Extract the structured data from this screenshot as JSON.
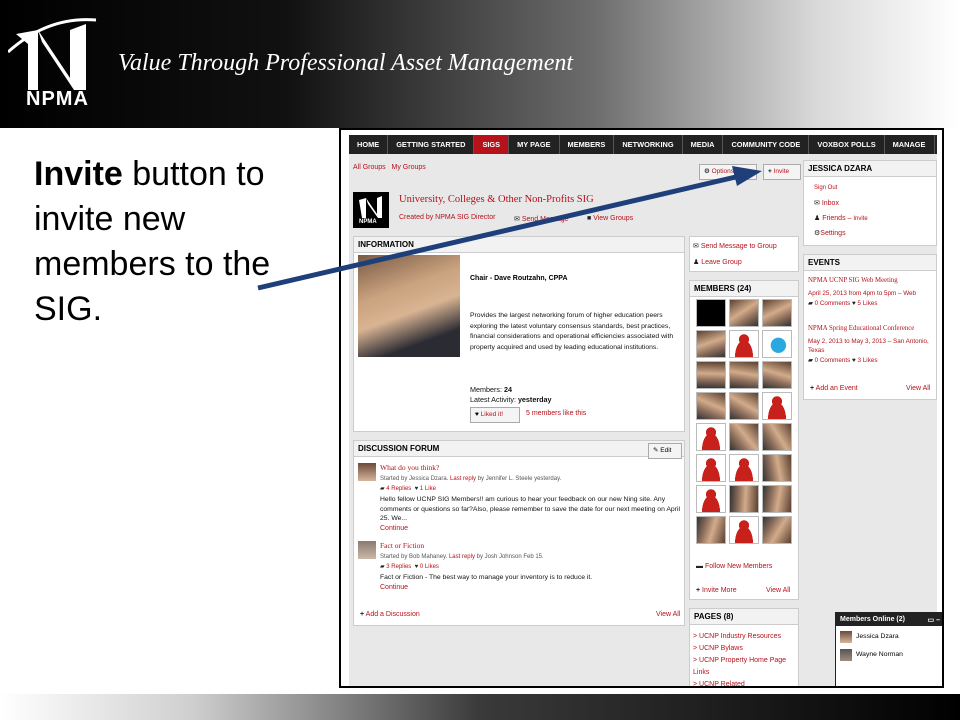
{
  "banner": {
    "logo_text": "NPMA",
    "tagline": "Value Through Professional Asset Management"
  },
  "callout": {
    "bold": "Invite",
    "rest": " button to invite new members to the SIG."
  },
  "nav": [
    "HOME",
    "GETTING STARTED",
    "SIGS",
    "MY PAGE",
    "MEMBERS",
    "NETWORKING",
    "MEDIA",
    "COMMUNITY CODE",
    "VOXBOX POLLS",
    "MANAGE"
  ],
  "crumbs": {
    "all_groups": "All Groups",
    "my_groups": "My Groups"
  },
  "buttons": {
    "options": "Options",
    "invite": "Invite"
  },
  "group": {
    "logo_text": "NPMA",
    "title": "University, Colleges & Other Non-Profits SIG",
    "created_by": "Created by NPMA SIG Director",
    "send_message": "Send Message",
    "view_groups": "View Groups"
  },
  "information": {
    "heading": "INFORMATION",
    "chair": "Chair - Dave Routzahn, CPPA",
    "description": "Provides the largest networking forum of higher education peers exploring the latest voluntary consensus standards, best practices, financial considerations and operational efficiencies associated  with property acquired and used by leading educational institutions.",
    "members_label": "Members: ",
    "members_count": "24",
    "activity_label": "Latest Activity: ",
    "activity_value": "yesterday",
    "liked_btn": "Liked it!",
    "likes_text": "5 members like this"
  },
  "group_actions": {
    "send_message": "Send Message to Group",
    "leave": "Leave Group"
  },
  "members": {
    "heading": "MEMBERS (24)",
    "follow": "Follow New Members",
    "invite_more": "Invite More",
    "view_all": "View All"
  },
  "pages": {
    "heading": "PAGES (8)",
    "items": [
      "> UCNP Industry Resources",
      "> UCNP Bylaws",
      "> UCNP Property Home Page Links",
      "> UCNP Related"
    ]
  },
  "forum": {
    "heading": "DISCUSSION FORUM",
    "edit": "Edit",
    "posts": [
      {
        "title": "What do you think?",
        "meta_pre": "Started by Jessica Dzara. ",
        "meta_link": "Last reply",
        "meta_post": " by Jennifer L. Steele yesterday.",
        "replies": "4 Replies",
        "likes": "1 Like",
        "body": "Hello fellow UCNP SIG Members!! am curious to hear your feedback on our new Ning site. Any comments or questions so far?Also, please remember to save the date for our next meeting on April 25. We...",
        "continue": "Continue"
      },
      {
        "title": "Fact or Fiction",
        "meta_pre": "Started by Bob Mahaney. ",
        "meta_link": "Last reply",
        "meta_post": " by Josh Johnson Feb 15.",
        "replies": "3 Replies",
        "likes": "0 Likes",
        "body": "Fact or Fiction - The best way to manage your inventory is to reduce it.",
        "continue": "Continue"
      }
    ],
    "add": "Add a Discussion",
    "view_all": "View All"
  },
  "user": {
    "name": "JESSICA DZARA",
    "sign_out": "Sign Out",
    "inbox": "Inbox",
    "friends": "Friends",
    "invite": "Invite",
    "settings": "Settings"
  },
  "events": {
    "heading": "EVENTS",
    "items": [
      {
        "title": "NPMA UCNP SIG Web Meeting",
        "when": "April 25, 2013 from 4pm to 5pm – Web",
        "comments": "0 Comments",
        "likes": "5 Likes"
      },
      {
        "title": "NPMA Spring Educational Conference",
        "when": "May 2, 2013 to May 3, 2013 – San Antonio, Texas",
        "comments": "0 Comments",
        "likes": "3 Likes"
      }
    ],
    "add": "Add an Event",
    "view_all": "View All"
  },
  "online": {
    "heading": "Members Online (2)",
    "users": [
      "Jessica Dzara",
      "Wayne Norman"
    ]
  },
  "colors": {
    "accent": "#b5121b",
    "nav": "#222222",
    "arrow": "#1f3f7a"
  }
}
